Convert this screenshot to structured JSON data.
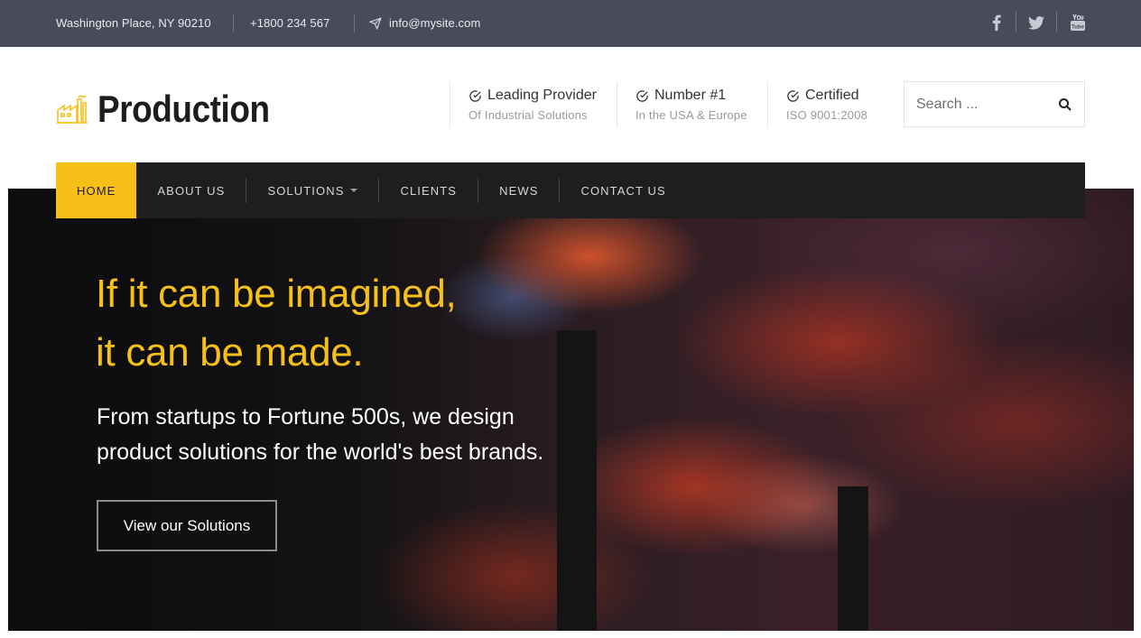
{
  "topbar": {
    "address": "Washington Place, NY 90210",
    "phone": "+1800 234 567",
    "email": "info@mysite.com",
    "social_icons": [
      "facebook-icon",
      "twitter-icon",
      "youtube-icon"
    ]
  },
  "brand": {
    "name": "Production",
    "logo_icon": "factory-icon",
    "accent_color": "#f7c019"
  },
  "features": [
    {
      "title": "Leading Provider",
      "subtitle": "Of Industrial Solutions",
      "icon": "check-circle-icon"
    },
    {
      "title": "Number #1",
      "subtitle": "In the USA & Europe",
      "icon": "check-circle-icon"
    },
    {
      "title": "Certified",
      "subtitle": "ISO 9001:2008",
      "icon": "check-circle-icon"
    }
  ],
  "search": {
    "placeholder": "Search ...",
    "icon": "search-icon"
  },
  "nav": {
    "items": [
      {
        "label": "HOME",
        "active": true
      },
      {
        "label": "ABOUT US"
      },
      {
        "label": "SOLUTIONS",
        "dropdown": true
      },
      {
        "label": "CLIENTS"
      },
      {
        "label": "NEWS"
      },
      {
        "label": "CONTACT US"
      }
    ]
  },
  "hero": {
    "title_line1": "If it can be imagined,",
    "title_line2": "it can be made.",
    "subtitle_line1": "From startups to Fortune 500s, we design",
    "subtitle_line2": "product solutions for the world's best brands.",
    "button_label": "View our Solutions"
  }
}
